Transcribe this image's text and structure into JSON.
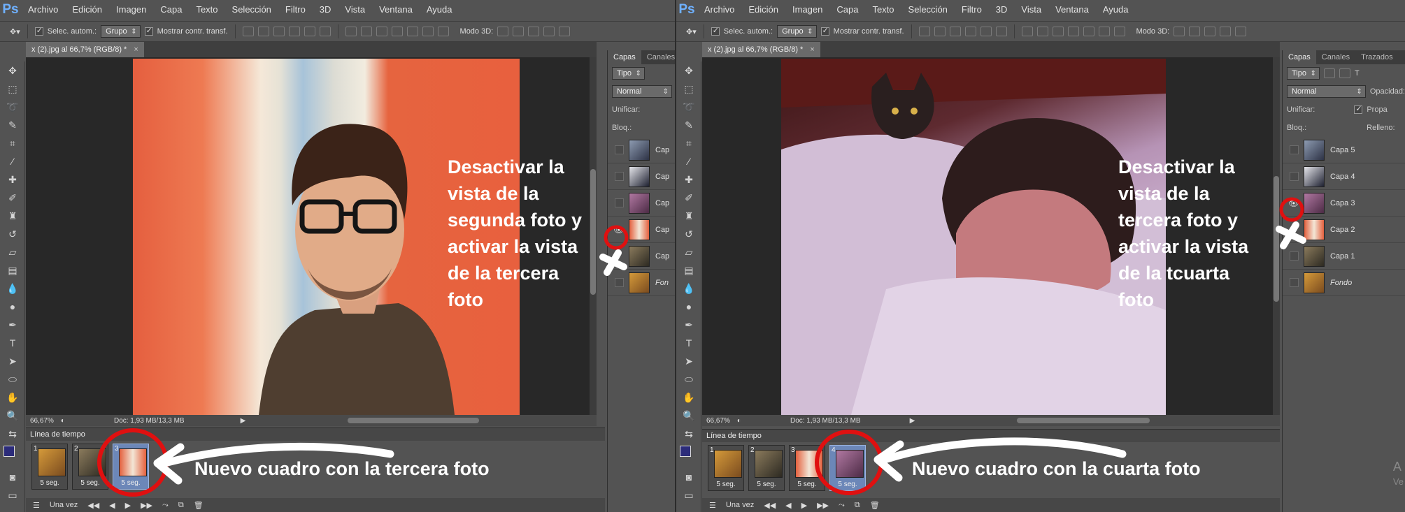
{
  "app": {
    "logo": "Ps"
  },
  "menu": [
    "Archivo",
    "Edición",
    "Imagen",
    "Capa",
    "Texto",
    "Selección",
    "Filtro",
    "3D",
    "Vista",
    "Ventana",
    "Ayuda"
  ],
  "options": {
    "auto_select": "Selec. autom.:",
    "group": "Grupo",
    "show_transform": "Mostrar contr. transf.",
    "mode3d": "Modo 3D:"
  },
  "left": {
    "doc_tab": "x (2).jpg al 66,7% (RGB/8) *",
    "zoom": "66,67%",
    "doc_size": "Doc: 1,93 MB/13,3 MB",
    "panel_tabs": [
      "Capas",
      "Canales"
    ],
    "kind": "Tipo",
    "blend": "Normal",
    "unify": "Unificar:",
    "lock": "Bloq.:",
    "layers": [
      "Cap",
      "Cap",
      "Cap",
      "Cap",
      "Cap",
      "Fon"
    ],
    "timeline_title": "Línea de tiempo",
    "frames": [
      {
        "num": "1",
        "dur": "5 seg."
      },
      {
        "num": "2",
        "dur": "5 seg."
      },
      {
        "num": "3",
        "dur": "5 seg."
      }
    ],
    "loop": "Una vez",
    "instruction": [
      "Desactivar la",
      "vista de la",
      "segunda foto y",
      "activar la vista",
      "de la tercera",
      "foto"
    ],
    "caption": "Nuevo cuadro con la tercera foto"
  },
  "right": {
    "doc_tab": "x (2).jpg al 66,7% (RGB/8) *",
    "zoom": "66,67%",
    "doc_size": "Doc: 1,93 MB/13,3 MB",
    "panel_tabs": [
      "Capas",
      "Canales",
      "Trazados"
    ],
    "kind": "Tipo",
    "blend": "Normal",
    "opacity": "Opacidad:",
    "unify": "Unificar:",
    "propagate": "Propa",
    "lock": "Bloq.:",
    "fill": "Relleno:",
    "layers": [
      "Capa 5",
      "Capa 4",
      "Capa 3",
      "Capa 2",
      "Capa 1",
      "Fondo"
    ],
    "timeline_title": "Línea de tiempo",
    "frames": [
      {
        "num": "1",
        "dur": "5 seg."
      },
      {
        "num": "2",
        "dur": "5 seg."
      },
      {
        "num": "3",
        "dur": "5 seg."
      },
      {
        "num": "4",
        "dur": "5 seg."
      }
    ],
    "loop": "Una vez",
    "instruction": [
      "Desactivar la",
      "vista de la",
      "tercera foto y",
      "activar la vista",
      "de la tcuarta",
      "foto"
    ],
    "caption": "Nuevo cuadro con la cuarta foto",
    "edge_text": [
      "A",
      "Ve"
    ]
  },
  "colors": {
    "annotation_red": "#e01010",
    "annotation_white": "#ffffff",
    "frame_selected": "#6c87b8"
  }
}
